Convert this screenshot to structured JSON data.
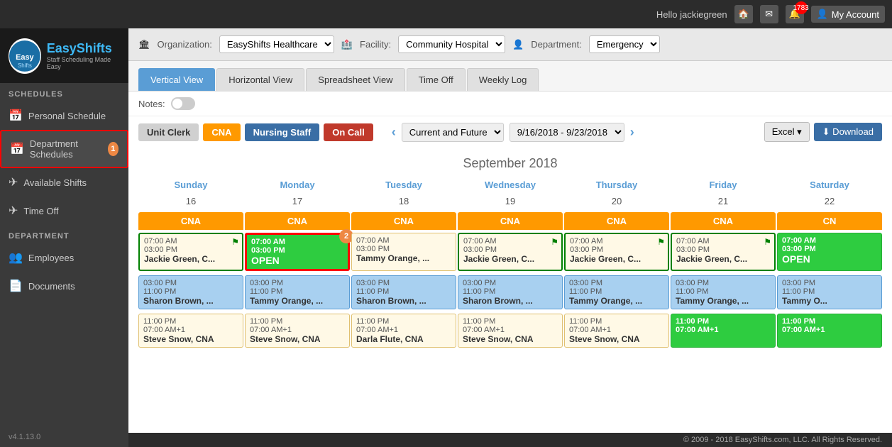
{
  "topbar": {
    "greeting": "Hello jackiegreen",
    "notif_count": "1783",
    "account_label": "My Account"
  },
  "logo": {
    "name": "EasyShifts",
    "tagline": "Staff Scheduling Made Easy"
  },
  "sidebar": {
    "schedules_label": "SCHEDULES",
    "department_label": "DEPARTMENT",
    "items": [
      {
        "id": "personal-schedule",
        "label": "Personal Schedule",
        "icon": "📅",
        "badge": null
      },
      {
        "id": "department-schedules",
        "label": "Department Schedules",
        "icon": "📅",
        "badge": "1",
        "active": true
      },
      {
        "id": "available-shifts",
        "label": "Available Shifts",
        "icon": "✈",
        "badge": null
      },
      {
        "id": "time-off",
        "label": "Time Off",
        "icon": "✈",
        "badge": null
      },
      {
        "id": "employees",
        "label": "Employees",
        "icon": "👥",
        "badge": null
      },
      {
        "id": "documents",
        "label": "Documents",
        "icon": "📄",
        "badge": null
      }
    ],
    "version": "v4.1.13.0"
  },
  "filter_bar": {
    "org_label": "Organization:",
    "org_value": "EasyShifts Healthcare",
    "facility_label": "Facility:",
    "facility_value": "Community Hospital",
    "dept_label": "Department:",
    "dept_value": "Emergency"
  },
  "tabs": [
    {
      "id": "vertical",
      "label": "Vertical View",
      "active": true
    },
    {
      "id": "horizontal",
      "label": "Horizontal View",
      "active": false
    },
    {
      "id": "spreadsheet",
      "label": "Spreadsheet View",
      "active": false
    },
    {
      "id": "timeoff",
      "label": "Time Off",
      "active": false
    },
    {
      "id": "weeklylog",
      "label": "Weekly Log",
      "active": false
    }
  ],
  "notes_label": "Notes:",
  "shift_buttons": [
    {
      "id": "unit-clerk",
      "label": "Unit Clerk",
      "style": "unit-clerk"
    },
    {
      "id": "cna",
      "label": "CNA",
      "style": "cna"
    },
    {
      "id": "nursing",
      "label": "Nursing Staff",
      "style": "nursing"
    },
    {
      "id": "oncall",
      "label": "On Call",
      "style": "oncall"
    }
  ],
  "nav": {
    "range_label": "Current and Future",
    "date_range": "9/16/2018 - 9/23/2018",
    "prev": "<",
    "next": ">",
    "excel_label": "Excel ▾",
    "download_label": "⬇ Download"
  },
  "calendar": {
    "title": "September 2018",
    "days": [
      "Sunday",
      "Monday",
      "Tuesday",
      "Wednesday",
      "Thursday",
      "Friday",
      "Saturday"
    ],
    "dates": [
      "16",
      "17",
      "18",
      "19",
      "20",
      "21",
      "22"
    ],
    "cna_label": "CNA",
    "shifts": [
      {
        "day": 0,
        "start": "07:00 AM",
        "end": "03:00 PM",
        "person": "Jackie Green, C...",
        "open": false,
        "green_flag": true
      },
      {
        "day": 1,
        "start": "07:00 AM",
        "end": "03:00 PM",
        "person": "OPEN",
        "open": true,
        "highlighted": true,
        "badge": "2"
      },
      {
        "day": 2,
        "start": "07:00 AM",
        "end": "03:00 PM",
        "person": "Tammy Orange, ...",
        "open": false
      },
      {
        "day": 3,
        "start": "07:00 AM",
        "end": "03:00 PM",
        "person": "Jackie Green, C...",
        "open": false,
        "green_flag": true
      },
      {
        "day": 4,
        "start": "07:00 AM",
        "end": "03:00 PM",
        "person": "Jackie Green, C...",
        "open": false,
        "green_flag": true
      },
      {
        "day": 5,
        "start": "07:00 AM",
        "end": "03:00 PM",
        "person": "Jackie Green, C...",
        "open": false,
        "green_flag": true
      },
      {
        "day": 6,
        "start": "07:00 AM",
        "end": "03:00 PM",
        "person": "OPEN",
        "open": true
      }
    ],
    "shifts2": [
      {
        "day": 0,
        "start": "03:00 PM",
        "end": "11:00 PM",
        "person": "Sharon Brown, ..."
      },
      {
        "day": 1,
        "start": "03:00 PM",
        "end": "11:00 PM",
        "person": "Tammy Orange, ..."
      },
      {
        "day": 2,
        "start": "03:00 PM",
        "end": "11:00 PM",
        "person": "Sharon Brown, ..."
      },
      {
        "day": 3,
        "start": "03:00 PM",
        "end": "11:00 PM",
        "person": "Sharon Brown, ..."
      },
      {
        "day": 4,
        "start": "03:00 PM",
        "end": "11:00 PM",
        "person": "Tammy Orange, ..."
      },
      {
        "day": 5,
        "start": "03:00 PM",
        "end": "11:00 PM",
        "person": "Tammy Orange, ..."
      },
      {
        "day": 6,
        "start": "03:00 PM",
        "end": "11:00 PM",
        "person": "Tammy O..."
      }
    ],
    "shifts3": [
      {
        "day": 0,
        "start": "11:00 PM",
        "end": "07:00 AM+1",
        "person": "Steve Snow, CNA"
      },
      {
        "day": 1,
        "start": "11:00 PM",
        "end": "07:00 AM+1",
        "person": "Steve Snow, CNA"
      },
      {
        "day": 2,
        "start": "11:00 PM",
        "end": "07:00 AM+1",
        "person": "Darla Flute, CNA"
      },
      {
        "day": 3,
        "start": "11:00 PM",
        "end": "07:00 AM+1",
        "person": "Steve Snow, CNA"
      },
      {
        "day": 4,
        "start": "11:00 PM",
        "end": "07:00 AM+1",
        "person": "Steve Snow, CNA"
      },
      {
        "day": 5,
        "start": "11:00 PM",
        "end": "07:00 AM+1",
        "person": "",
        "open": true
      },
      {
        "day": 6,
        "start": "11:00 PM",
        "end": "07:00 AM+1",
        "person": ""
      }
    ]
  },
  "footer": {
    "text": "© 2009 - 2018 EasyShifts.com, LLC. All Rights Reserved."
  }
}
